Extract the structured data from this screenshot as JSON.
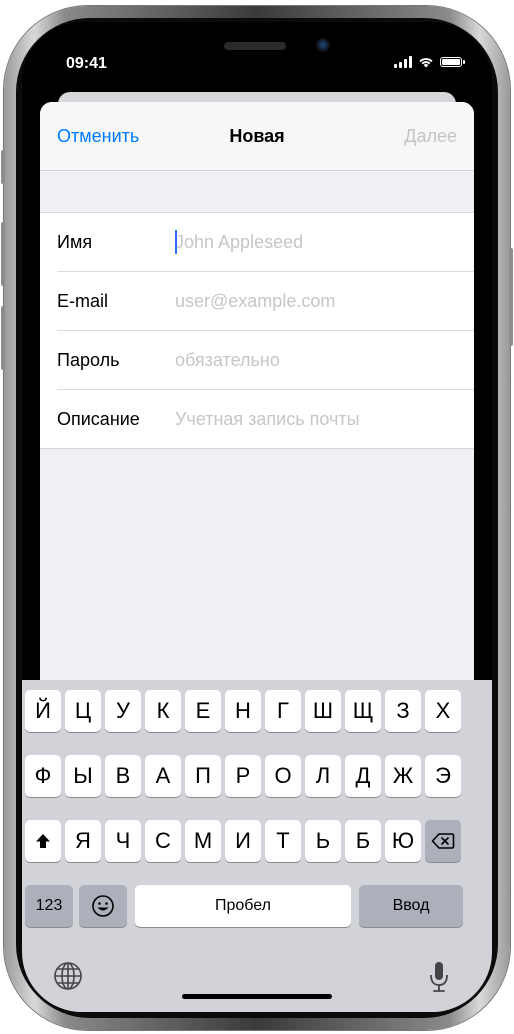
{
  "status_bar": {
    "time": "09:41"
  },
  "nav": {
    "cancel": "Отменить",
    "title": "Новая",
    "next": "Далее"
  },
  "form": {
    "rows": [
      {
        "label": "Имя",
        "placeholder": "John Appleseed"
      },
      {
        "label": "E-mail",
        "placeholder": "user@example.com"
      },
      {
        "label": "Пароль",
        "placeholder": "обязательно"
      },
      {
        "label": "Описание",
        "placeholder": "Учетная запись почты"
      }
    ]
  },
  "keyboard": {
    "row1": [
      "Й",
      "Ц",
      "У",
      "К",
      "Е",
      "Н",
      "Г",
      "Ш",
      "Щ",
      "З",
      "Х"
    ],
    "row2": [
      "Ф",
      "Ы",
      "В",
      "А",
      "П",
      "Р",
      "О",
      "Л",
      "Д",
      "Ж",
      "Э"
    ],
    "row3": [
      "Я",
      "Ч",
      "С",
      "М",
      "И",
      "Т",
      "Ь",
      "Б",
      "Ю"
    ],
    "numbers_key": "123",
    "space_key": "Пробел",
    "return_key": "Ввод",
    "icons": {
      "shift": "shift-icon",
      "delete": "delete-icon",
      "emoji": "emoji-icon",
      "globe": "globe-icon",
      "mic": "microphone-icon"
    }
  },
  "colors": {
    "accent": "#007aff",
    "disabled": "#c4c4c8",
    "keyboard_bg": "#d1d3d9"
  }
}
